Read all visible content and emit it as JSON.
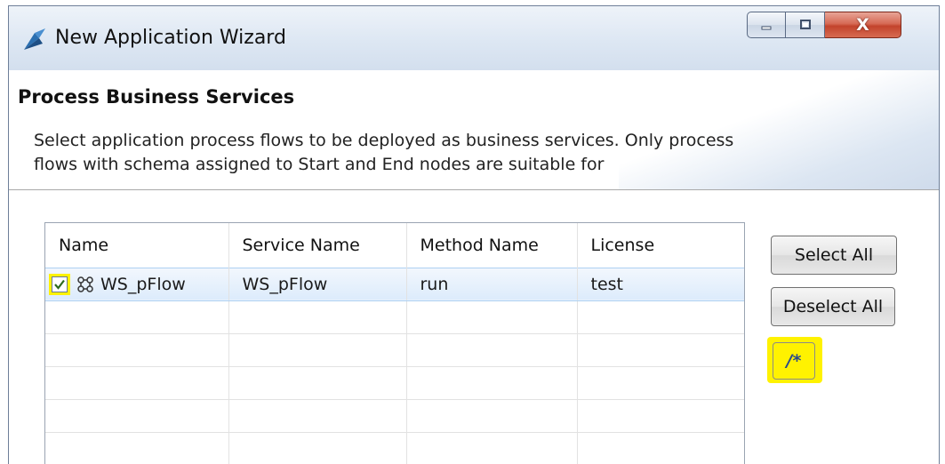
{
  "window": {
    "title": "New Application Wizard",
    "controls": {
      "minimize_icon": "minimize-icon",
      "maximize_icon": "maximize-icon",
      "close_label": "X"
    }
  },
  "header": {
    "title": "Process Business Services",
    "description": "Select application process flows to be deployed as business services. Only process flows with schema assigned to Start and End nodes are suitable for"
  },
  "table": {
    "columns": [
      "Name",
      "Service Name",
      "Method Name",
      "License"
    ],
    "rows": [
      {
        "checked": true,
        "icon": "process-flow-icon",
        "name": "WS_pFlow",
        "service_name": "WS_pFlow",
        "method_name": "run",
        "license": "test"
      }
    ],
    "empty_rows": 5
  },
  "buttons": {
    "select_all": "Select All",
    "deselect_all": "Deselect All",
    "code_view": "/*"
  },
  "colors": {
    "highlight": "#fff200",
    "selection": "#dcebfc",
    "titlebar": "#dde7f3",
    "close_button": "#c2432c"
  }
}
